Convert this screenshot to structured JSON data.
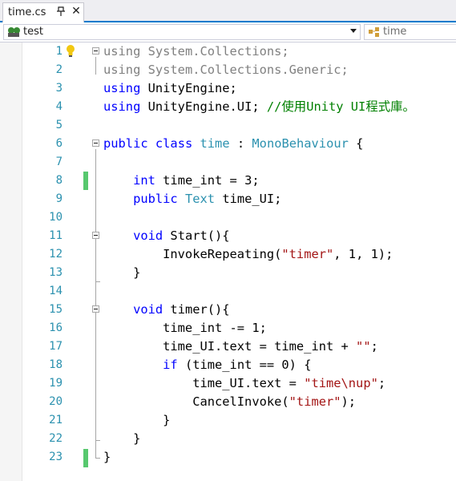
{
  "tab": {
    "title": "time.cs"
  },
  "navbar": {
    "left_value": "test",
    "right_value": "time"
  },
  "code_lines": [
    {
      "n": "1",
      "tokens": [
        [
          "using",
          "gray"
        ],
        [
          " System.Collections;",
          "gray"
        ]
      ]
    },
    {
      "n": "2",
      "tokens": [
        [
          "using",
          "gray"
        ],
        [
          " System.Collections.Generic;",
          "gray"
        ]
      ]
    },
    {
      "n": "3",
      "tokens": [
        [
          "using",
          "kw"
        ],
        [
          " UnityEngine;",
          ""
        ]
      ]
    },
    {
      "n": "4",
      "tokens": [
        [
          "using",
          "kw"
        ],
        [
          " UnityEngine.UI; ",
          ""
        ],
        [
          "//使用Unity UI程式庫。",
          "cm"
        ]
      ]
    },
    {
      "n": "5",
      "tokens": []
    },
    {
      "n": "6",
      "tokens": [
        [
          "public",
          "kw"
        ],
        [
          " ",
          ""
        ],
        [
          "class",
          "kw"
        ],
        [
          " ",
          ""
        ],
        [
          "time",
          "ty"
        ],
        [
          " : ",
          ""
        ],
        [
          "MonoBehaviour",
          "ty"
        ],
        [
          " {",
          ""
        ]
      ]
    },
    {
      "n": "7",
      "tokens": []
    },
    {
      "n": "8",
      "tokens": [
        [
          "    ",
          ""
        ],
        [
          "int",
          "kw"
        ],
        [
          " time_int = 3;",
          ""
        ]
      ]
    },
    {
      "n": "9",
      "tokens": [
        [
          "    ",
          ""
        ],
        [
          "public",
          "kw"
        ],
        [
          " ",
          ""
        ],
        [
          "Text",
          "ty"
        ],
        [
          " time_UI;",
          ""
        ]
      ]
    },
    {
      "n": "10",
      "tokens": []
    },
    {
      "n": "11",
      "tokens": [
        [
          "    ",
          ""
        ],
        [
          "void",
          "kw"
        ],
        [
          " Start(){",
          ""
        ]
      ]
    },
    {
      "n": "12",
      "tokens": [
        [
          "        InvokeRepeating(",
          ""
        ],
        [
          "\"timer\"",
          "str"
        ],
        [
          ", 1, 1);",
          ""
        ]
      ]
    },
    {
      "n": "13",
      "tokens": [
        [
          "    }",
          ""
        ]
      ]
    },
    {
      "n": "14",
      "tokens": []
    },
    {
      "n": "15",
      "tokens": [
        [
          "    ",
          ""
        ],
        [
          "void",
          "kw"
        ],
        [
          " timer(){",
          ""
        ]
      ]
    },
    {
      "n": "16",
      "tokens": [
        [
          "        time_int -= 1;",
          ""
        ]
      ]
    },
    {
      "n": "17",
      "tokens": [
        [
          "        time_UI.text = time_int + ",
          ""
        ],
        [
          "\"\"",
          "str"
        ],
        [
          ";",
          ""
        ]
      ]
    },
    {
      "n": "18",
      "tokens": [
        [
          "        ",
          ""
        ],
        [
          "if",
          "kw"
        ],
        [
          " (time_int == 0) {",
          ""
        ]
      ]
    },
    {
      "n": "19",
      "tokens": [
        [
          "            time_UI.text = ",
          ""
        ],
        [
          "\"time\\nup\"",
          "str"
        ],
        [
          ";",
          ""
        ]
      ]
    },
    {
      "n": "20",
      "tokens": [
        [
          "            CancelInvoke(",
          ""
        ],
        [
          "\"timer\"",
          "str"
        ],
        [
          ");",
          ""
        ]
      ]
    },
    {
      "n": "21",
      "tokens": [
        [
          "        }",
          ""
        ]
      ]
    },
    {
      "n": "22",
      "tokens": [
        [
          "    }",
          ""
        ]
      ]
    },
    {
      "n": "23",
      "tokens": [
        [
          "}",
          ""
        ]
      ]
    }
  ]
}
